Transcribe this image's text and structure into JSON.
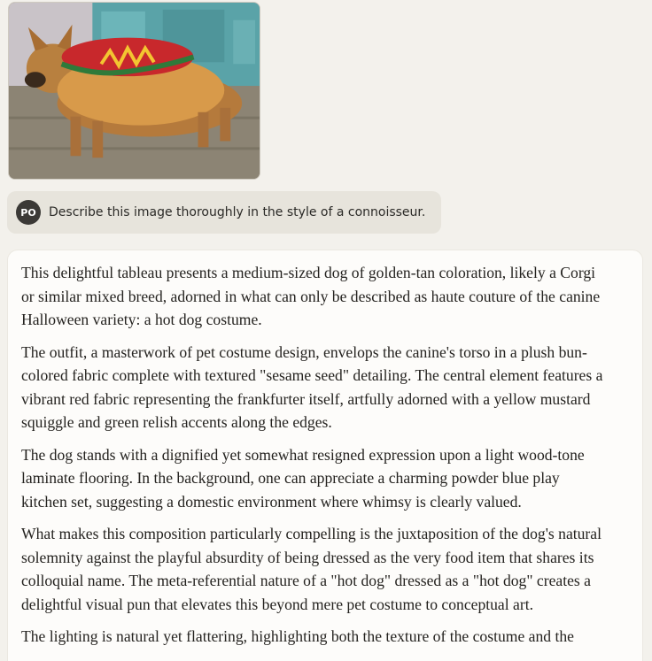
{
  "attachment": {
    "icon": "image-thumbnail"
  },
  "user_message": {
    "avatar_initials": "PO",
    "text": "Describe this image thoroughly in the style of a connoisseur."
  },
  "response": {
    "paragraphs": [
      "This delightful tableau presents a medium-sized dog of golden-tan coloration, likely a Corgi or similar mixed breed, adorned in what can only be described as haute couture of the canine Halloween variety: a hot dog costume.",
      "The outfit, a masterwork of pet costume design, envelops the canine's torso in a plush bun-colored fabric complete with textured \"sesame seed\" detailing. The central element features a vibrant red fabric representing the frankfurter itself, artfully adorned with a yellow mustard squiggle and green relish accents along the edges.",
      "The dog stands with a dignified yet somewhat resigned expression upon a light wood-tone laminate flooring. In the background, one can appreciate a charming powder blue play kitchen set, suggesting a domestic environment where whimsy is clearly valued.",
      "What makes this composition particularly compelling is the juxtaposition of the dog's natural solemnity against the playful absurdity of being dressed as the very food item that shares its colloquial name. The meta-referential nature of a \"hot dog\" dressed as a \"hot dog\" creates a delightful visual pun that elevates this beyond mere pet costume to conceptual art.",
      "The lighting is natural yet flattering, highlighting both the texture of the costume and the"
    ]
  }
}
